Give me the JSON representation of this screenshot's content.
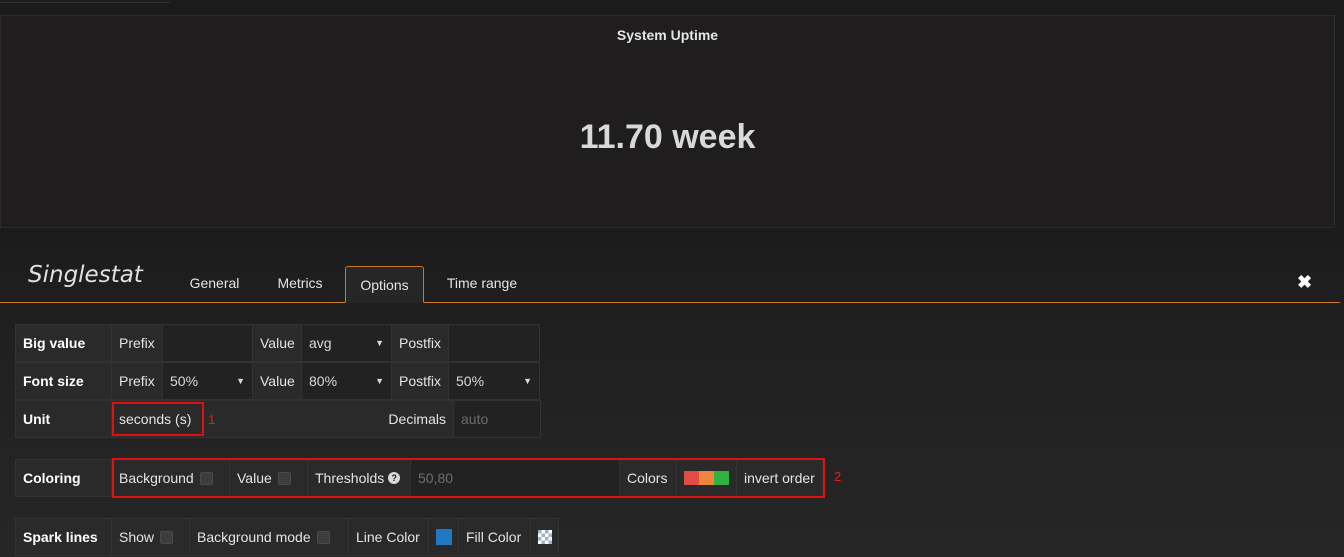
{
  "panel": {
    "title": "System Uptime",
    "value": "11.70 week"
  },
  "editor": {
    "title": "Singlestat",
    "tabs": [
      "General",
      "Metrics",
      "Options",
      "Time range"
    ],
    "active_tab": "Options"
  },
  "big_value": {
    "label": "Big value",
    "prefix_label": "Prefix",
    "prefix_value": "",
    "value_label": "Value",
    "value_select": "avg",
    "postfix_label": "Postfix",
    "postfix_value": ""
  },
  "font_size": {
    "label": "Font size",
    "prefix_label": "Prefix",
    "prefix_select": "50%",
    "value_label": "Value",
    "value_select": "80%",
    "postfix_label": "Postfix",
    "postfix_select": "50%"
  },
  "unit": {
    "label": "Unit",
    "value": "seconds (s)",
    "decimals_label": "Decimals",
    "decimals_placeholder": "auto"
  },
  "coloring": {
    "label": "Coloring",
    "background_label": "Background",
    "value_label": "Value",
    "thresholds_label": "Thresholds",
    "thresholds_value": "50,80",
    "colors_label": "Colors",
    "colors": [
      "#e24d42",
      "#ef843c",
      "#2fb240"
    ],
    "invert_label": "invert order"
  },
  "sparklines": {
    "label": "Spark lines",
    "show_label": "Show",
    "bg_mode_label": "Background mode",
    "line_color_label": "Line Color",
    "line_color": "#1f78c1",
    "fill_color_label": "Fill Color"
  },
  "annotations": {
    "one": "1",
    "two": "2"
  }
}
